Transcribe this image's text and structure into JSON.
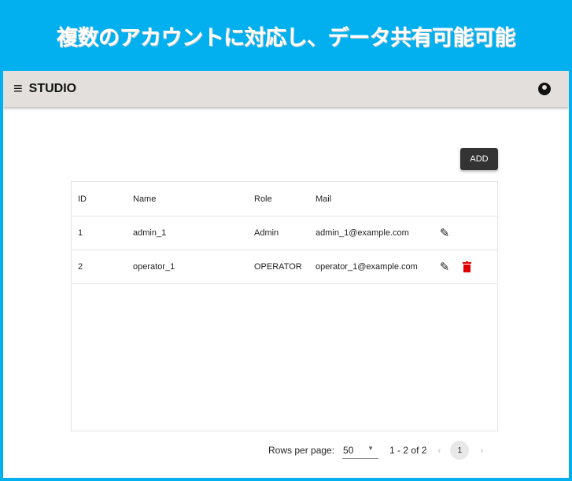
{
  "banner": {
    "text": "複数のアカウントに対応し、データ共有可能可能"
  },
  "appbar": {
    "title": "STUDIO"
  },
  "add_label": "ADD",
  "table": {
    "headers": [
      "ID",
      "Name",
      "Role",
      "Mail"
    ],
    "rows": [
      {
        "id": "1",
        "name": "admin_1",
        "role": "Admin",
        "mail": "admin_1@example.com"
      },
      {
        "id": "2",
        "name": "operator_1",
        "role": "OPERATOR",
        "mail": "operator_1@example.com"
      }
    ]
  },
  "pager": {
    "rows_label": "Rows per page:",
    "rows_value": "50",
    "range": "1 - 2 of 2",
    "page": "1"
  },
  "colors": {
    "accent": "#03b0ef",
    "delete": "#e00000"
  }
}
